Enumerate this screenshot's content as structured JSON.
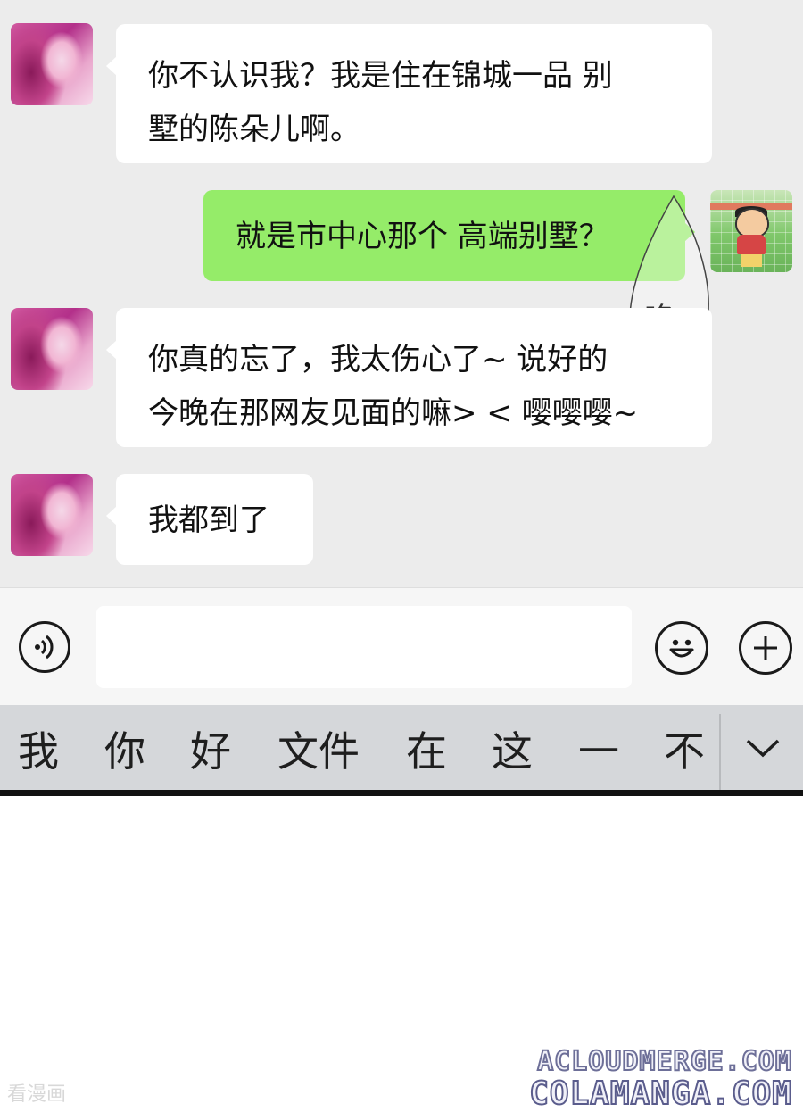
{
  "messages": [
    {
      "side": "left",
      "text": "你不认识我？我是住在锦城一品 别\n墅的陈朵儿啊。"
    },
    {
      "side": "right",
      "text": "就是市中心那个 高端别墅？"
    },
    {
      "side": "left",
      "text": "你真的忘了，我太伤心了~ 说好的\n今晚在那网友见面的嘛> < 嘤嘤嘤~"
    },
    {
      "side": "left",
      "text": "我都到了"
    }
  ],
  "sound_effect": "咚",
  "input": {
    "value": "",
    "placeholder": ""
  },
  "toolbar": {
    "voice_icon": "voice-icon",
    "emoji_icon": "emoji-icon",
    "add_icon": "plus-icon"
  },
  "suggestions": [
    "我",
    "你",
    "好",
    "文件",
    "在",
    "这",
    "一",
    "不"
  ],
  "watermarks": [
    "ACLOUDMERGE.COM",
    "COLAMANGA.COM",
    "看漫画"
  ],
  "colors": {
    "outgoing_bubble": "#95ec69",
    "incoming_bubble": "#ffffff",
    "chat_background": "#ececec"
  }
}
